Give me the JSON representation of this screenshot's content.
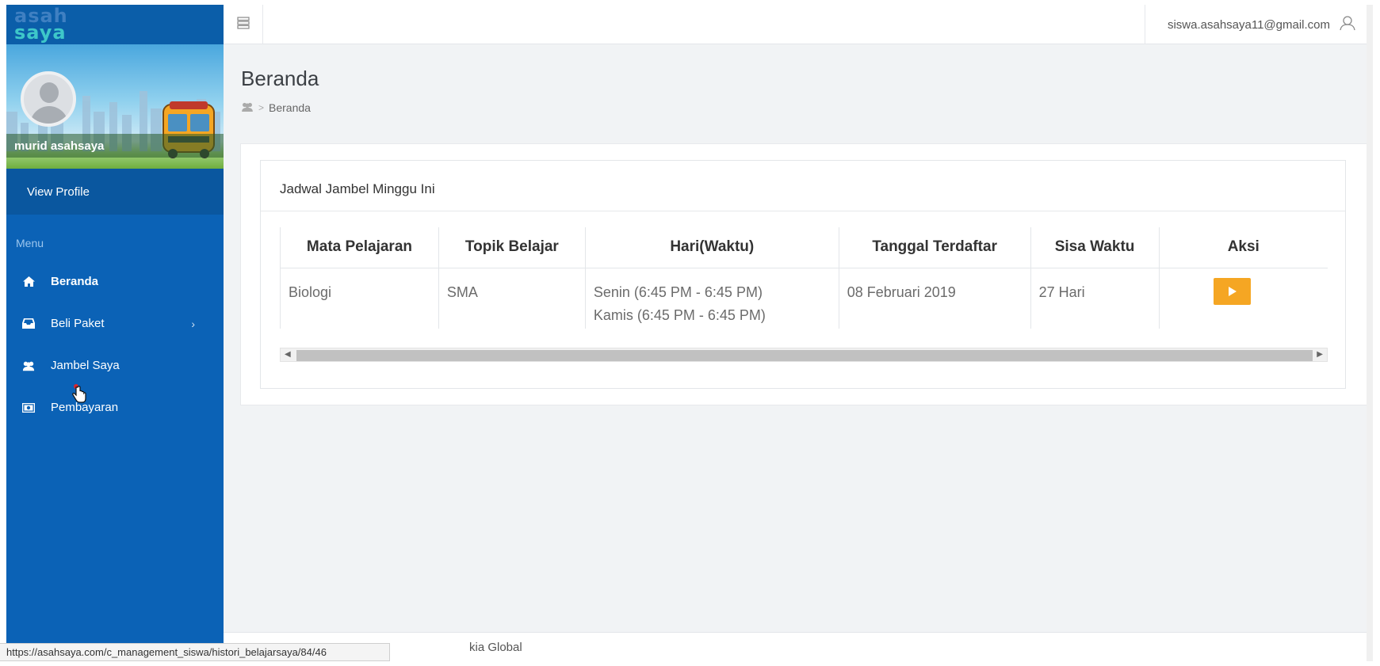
{
  "sidebar": {
    "logo_line1": "asah",
    "logo_line2": "saya",
    "username": "murid asahsaya",
    "view_profile": "View Profile",
    "menu_label": "Menu",
    "items": [
      {
        "label": "Beranda",
        "icon": "home-icon",
        "active": true
      },
      {
        "label": "Beli Paket",
        "icon": "inbox-icon",
        "has_submenu": true
      },
      {
        "label": "Jambel Saya",
        "icon": "users-icon"
      },
      {
        "label": "Pembayaran",
        "icon": "money-icon"
      }
    ]
  },
  "topbar": {
    "email": "siswa.asahsaya11@gmail.com"
  },
  "page": {
    "title": "Beranda",
    "breadcrumb": "Beranda"
  },
  "schedule": {
    "title": "Jadwal Jambel Minggu Ini",
    "headers": [
      "Mata Pelajaran",
      "Topik Belajar",
      "Hari(Waktu)",
      "Tanggal Terdaftar",
      "Sisa Waktu",
      "Aksi"
    ],
    "rows": [
      {
        "subject": "Biologi",
        "topic": "SMA",
        "time_line1": "Senin (6:45 PM - 6:45 PM)",
        "time_line2": "Kamis (6:45 PM - 6:45 PM)",
        "registered": "08 Februari 2019",
        "remaining": "27 Hari"
      }
    ]
  },
  "footer": {
    "text": "kia Global"
  },
  "status_bar": {
    "url": "https://asahsaya.com/c_management_siswa/histori_belajarsaya/84/46"
  },
  "colors": {
    "sidebar": "#0b62b6",
    "accent_button": "#f5a623"
  }
}
